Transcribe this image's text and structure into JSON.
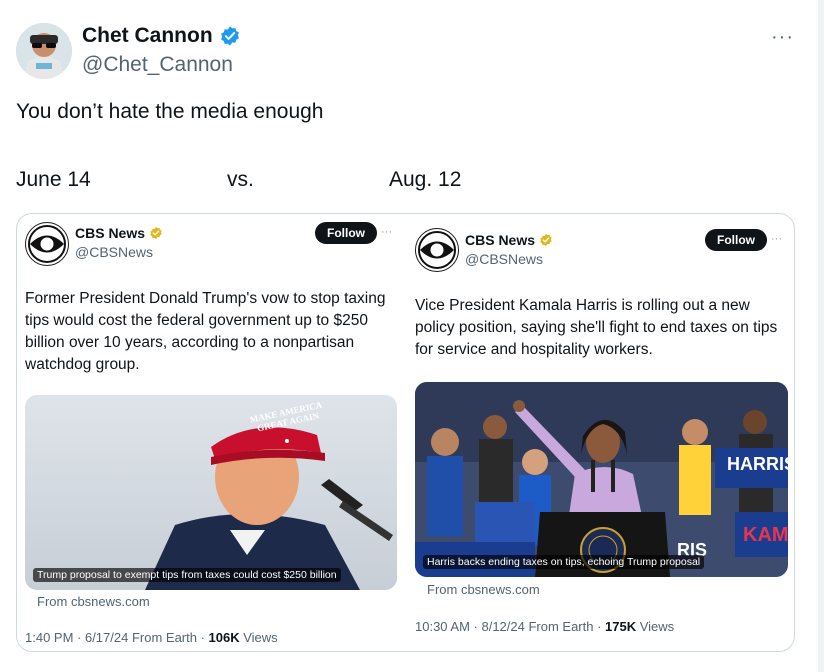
{
  "author": {
    "name": "Chet Cannon",
    "handle": "@Chet_Cannon"
  },
  "tweet": {
    "text": "You don’t hate the media enough",
    "more_label": "···"
  },
  "comparison": {
    "left_date": "June 14",
    "separator": "vs.",
    "right_date": "Aug. 12"
  },
  "cards": [
    {
      "account_name": "CBS News",
      "account_handle": "@CBSNews",
      "follow_label": "Follow",
      "more_label": "···",
      "text": "Former President Donald Trump's vow to stop taxing tips would cost the federal government up to $250 billion over 10 years, according to a nonpartisan watchdog group.",
      "image_caption": "Trump proposal to exempt tips from taxes could cost $250 billion",
      "hat_text": "MAKE AMERICA GREAT AGAIN",
      "source": "From cbsnews.com",
      "time": "1:40 PM · 6/17/24 From Earth · ",
      "views_count": "106K",
      "views_label": " Views"
    },
    {
      "account_name": "CBS News",
      "account_handle": "@CBSNews",
      "follow_label": "Follow",
      "more_label": "···",
      "text": "Vice President Kamala Harris is rolling out a new policy position, saying she'll fight to end taxes on tips for service and hospitality workers.",
      "image_caption": "Harris backs ending taxes on tips, echoing Trump proposal",
      "sign_text_1": "HARRIS",
      "sign_text_2": "KAMA",
      "sign_text_3": "RIS",
      "source": "From cbsnews.com",
      "time": "10:30 AM · 8/12/24 From Earth · ",
      "views_count": "175K",
      "views_label": " Views"
    }
  ],
  "colors": {
    "verified_blue": "#1d9bf0",
    "verified_gold": "#e2b719",
    "text_secondary": "#536471",
    "border": "#cfd9de"
  }
}
